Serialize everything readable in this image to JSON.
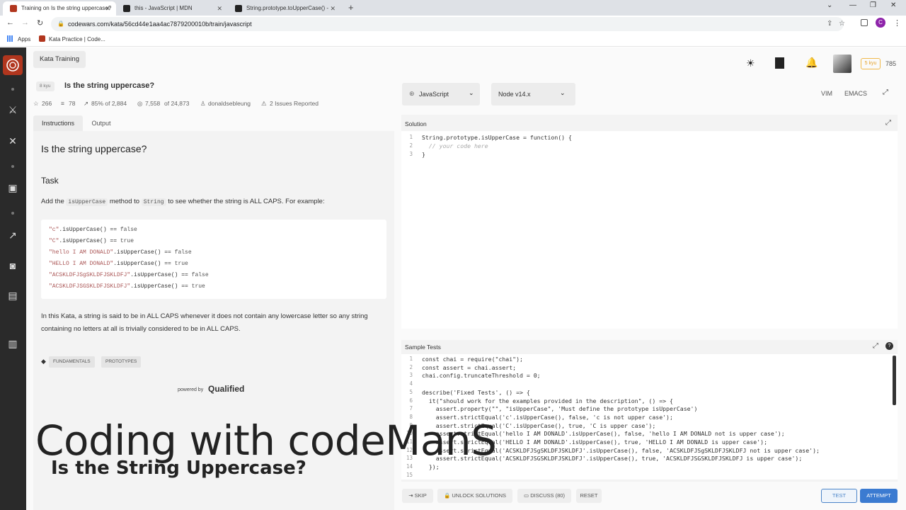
{
  "browser": {
    "tabs": [
      {
        "title": "Training on Is the string uppercase?",
        "active": true
      },
      {
        "title": "this - JavaScript | MDN",
        "active": false
      },
      {
        "title": "String.prototype.toUpperCase() -",
        "active": false
      }
    ],
    "new_tab": "+",
    "url": "codewars.com/kata/56cd44e1aa4ac7879200010b/train/javascript",
    "bookmarks": [
      "Apps",
      "Kata Practice | Code..."
    ],
    "profile_initial": "C"
  },
  "header": {
    "section": "Kata Training",
    "honor": "785",
    "rank_badge": "5 kyu"
  },
  "kata": {
    "rank": "8 kyu",
    "title": "Is the string uppercase?",
    "stars": "266",
    "collections": "78",
    "satisfaction": "85% of 2,884",
    "completed_a": "7,558",
    "completed_of": "of 24,873",
    "author": "donaldsebleung",
    "issues": "2 Issues Reported"
  },
  "desc_tabs": [
    "Instructions",
    "Output"
  ],
  "description": {
    "heading": "Is the string uppercase?",
    "task_heading": "Task",
    "intro_add": "Add the",
    "intro_method": "isUpperCase",
    "intro_to": "method to",
    "intro_string": "String",
    "intro_rest": "to see whether the string is ALL CAPS. For example:",
    "examples": [
      {
        "str": "\"c\"",
        "call": ".isUpperCase() == ",
        "res": "false"
      },
      {
        "str": "\"C\"",
        "call": ".isUpperCase() == ",
        "res": "true"
      },
      {
        "str": "\"hello I AM DONALD\"",
        "call": ".isUpperCase() == ",
        "res": "false"
      },
      {
        "str": "\"HELLO I AM DONALD\"",
        "call": ".isUpperCase() == ",
        "res": "true"
      },
      {
        "str": "\"ACSKLDFJSgSKLDFJSKLDFJ\"",
        "call": ".isUpperCase() == ",
        "res": "false"
      },
      {
        "str": "\"ACSKLDFJSGSKLDFJSKLDFJ\"",
        "call": ".isUpperCase() == ",
        "res": "true"
      }
    ],
    "paragraph": "In this Kata, a string is said to be in ALL CAPS whenever it does not contain any lowercase letter so any string containing no letters at all is trivially considered to be in ALL CAPS.",
    "tags": [
      "FUNDAMENTALS",
      "PROTOTYPES"
    ],
    "powered_by": "powered by",
    "qualified": "Qualified"
  },
  "editor": {
    "language": "JavaScript",
    "version": "Node v14.x",
    "modes": [
      "VIM",
      "EMACS"
    ],
    "solution_label": "Solution",
    "solution_lines": [
      "String.prototype.isUpperCase = function() {",
      "  // your code here",
      "}"
    ],
    "tests_label": "Sample Tests",
    "test_lines": [
      "const chai = require(\"chai\");",
      "const assert = chai.assert;",
      "chai.config.truncateThreshold = 0;",
      "",
      "describe('Fixed Tests', () => {",
      "  it(\"should work for the examples provided in the description\", () => {",
      "    assert.property(\"\", \"isUpperCase\", 'Must define the prototype isUpperCase')",
      "    assert.strictEqual('c'.isUpperCase(), false, 'c is not upper case');",
      "    assert.strictEqual('C'.isUpperCase(), true, 'C is upper case');",
      "    assert.strictEqual('hello I AM DONALD'.isUpperCase(), false, 'hello I AM DONALD not is upper case');",
      "    assert.strictEqual('HELLO I AM DONALD'.isUpperCase(), true, 'HELLO I AM DONALD is upper case');",
      "    assert.strictEqual('ACSKLDFJSgSKLDFJSKLDFJ'.isUpperCase(), false, 'ACSKLDFJSgSKLDFJSKLDFJ not is upper case');",
      "    assert.strictEqual('ACSKLDFJSGSKLDFJSKLDFJ'.isUpperCase(), true, 'ACSKLDFJSGSKLDFJSKLDFJ is upper case');",
      "  });",
      ""
    ]
  },
  "actions": {
    "skip": "SKIP",
    "unlock": "UNLOCK SOLUTIONS",
    "discuss": "DISCUSS (80)",
    "reset": "RESET",
    "test": "TEST",
    "attempt": "ATTEMPT"
  },
  "overlay": {
    "title": "Coding with codeManS",
    "subtitle": "Is the String Uppercase?"
  }
}
